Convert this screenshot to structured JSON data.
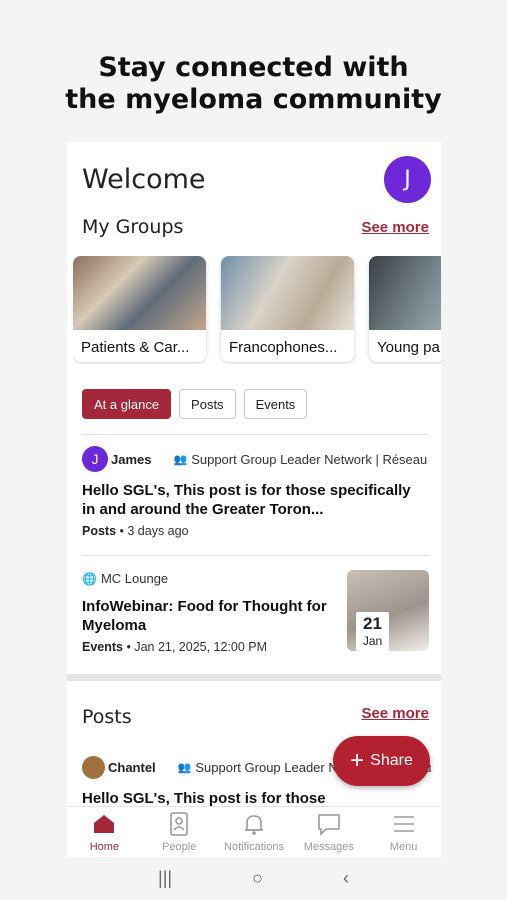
{
  "headline": {
    "line1": "Stay connected with",
    "line2": "the myeloma community"
  },
  "header": {
    "welcome": "Welcome",
    "avatar_initial": "J"
  },
  "groups_section": {
    "title": "My Groups",
    "see_more": "See more",
    "cards": [
      {
        "label": "Patients & Car..."
      },
      {
        "label": "Francophones..."
      },
      {
        "label": "Young pa"
      }
    ]
  },
  "tabs": [
    {
      "label": "At a glance",
      "active": true
    },
    {
      "label": "Posts",
      "active": false
    },
    {
      "label": "Events",
      "active": false
    }
  ],
  "feed": [
    {
      "avatar_initial": "J",
      "author": "James",
      "group": "Support Group Leader Network | Réseau",
      "title": "Hello SGL's, This post is for those specifically in and around the Greater Toron...",
      "type": "Posts",
      "time": "3 days ago"
    },
    {
      "group": "MC Lounge",
      "title": "InfoWebinar: Food for Thought for Myeloma",
      "type": "Events",
      "time": "Jan 21, 2025, 12:00 PM",
      "date_day": "21",
      "date_month": "Jan"
    }
  ],
  "posts_section": {
    "title": "Posts",
    "see_more": "See more",
    "first_post": {
      "author": "Chantel",
      "group": "Support Group Leader Network | Réseau",
      "title": "Hello SGL's, This post is for those"
    }
  },
  "share_button": {
    "label": "Share"
  },
  "bottom_nav": [
    {
      "label": "Home",
      "icon": "home-icon",
      "active": true
    },
    {
      "label": "People",
      "icon": "people-icon",
      "active": false
    },
    {
      "label": "Notifications",
      "icon": "bell-icon",
      "active": false
    },
    {
      "label": "Messages",
      "icon": "message-icon",
      "active": false
    },
    {
      "label": "Menu",
      "icon": "menu-icon",
      "active": false
    }
  ],
  "system_nav": {
    "recents": "|||",
    "home": "○",
    "back": "‹"
  },
  "colors": {
    "accent": "#a4283a",
    "avatar": "#6d28d9",
    "share": "#b3202f"
  }
}
